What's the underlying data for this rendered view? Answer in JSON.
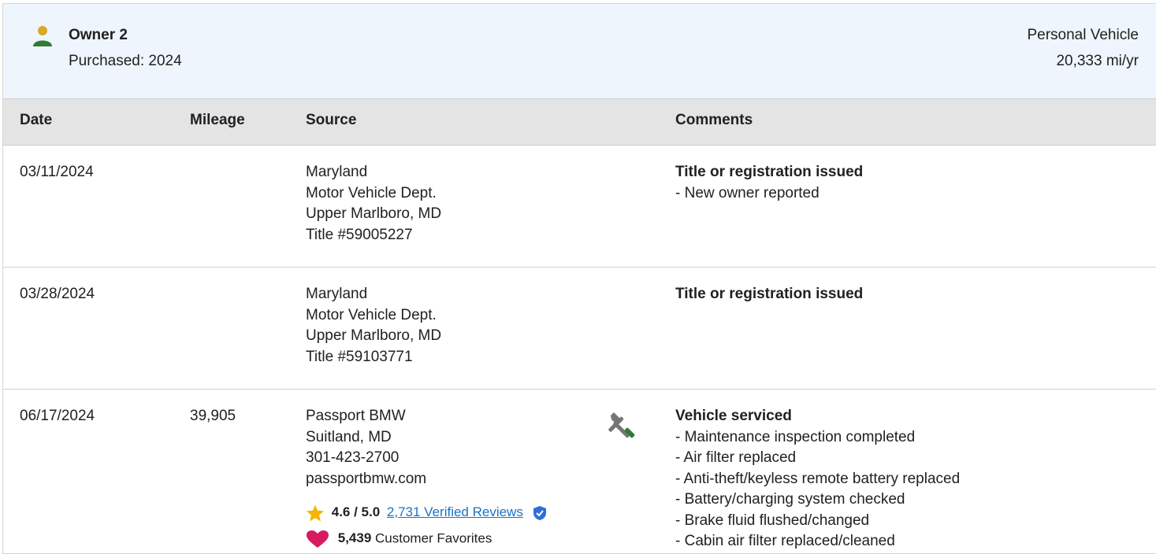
{
  "owner": {
    "name": "Owner 2",
    "purchased": "Purchased: 2024",
    "use_type": "Personal Vehicle",
    "miles_per_year": "20,333 mi/yr"
  },
  "columns": {
    "date": "Date",
    "mileage": "Mileage",
    "source": "Source",
    "comments": "Comments"
  },
  "rows": [
    {
      "date": "03/11/2024",
      "mileage": "",
      "source": [
        "Maryland",
        "Motor Vehicle Dept.",
        "Upper Marlboro, MD",
        "Title #59005227"
      ],
      "comment_title": "Title or registration issued",
      "comment_items": [
        "- New owner reported"
      ]
    },
    {
      "date": "03/28/2024",
      "mileage": "",
      "source": [
        "Maryland",
        "Motor Vehicle Dept.",
        "Upper Marlboro, MD",
        "Title #59103771"
      ],
      "comment_title": "Title or registration issued",
      "comment_items": []
    },
    {
      "date": "06/17/2024",
      "mileage": "39,905",
      "source": [
        "Passport BMW",
        "Suitland, MD",
        "301-423-2700",
        "passportbmw.com"
      ],
      "source_icon": "tools-icon",
      "rating": {
        "score": "4.6 / 5.0",
        "reviews_link": "2,731 Verified Reviews"
      },
      "favorites": {
        "count": "5,439",
        "label": "Customer Favorites"
      },
      "comment_title": "Vehicle serviced",
      "comment_items": [
        "- Maintenance inspection completed",
        "- Air filter replaced",
        "- Anti-theft/keyless remote battery replaced",
        "- Battery/charging system checked",
        "- Brake fluid flushed/changed",
        "- Cabin air filter replaced/cleaned"
      ]
    }
  ],
  "icons": {
    "owner": "person-icon",
    "rating": "star-icon",
    "verified": "verified-shield-icon",
    "favorites": "heart-icon"
  },
  "colors": {
    "header_bg": "#eef5fc",
    "table_head_bg": "#e4e4e4",
    "link": "#1a73c8",
    "star": "#f5b400",
    "heart": "#d81b60",
    "verified": "#2f6fd6"
  }
}
